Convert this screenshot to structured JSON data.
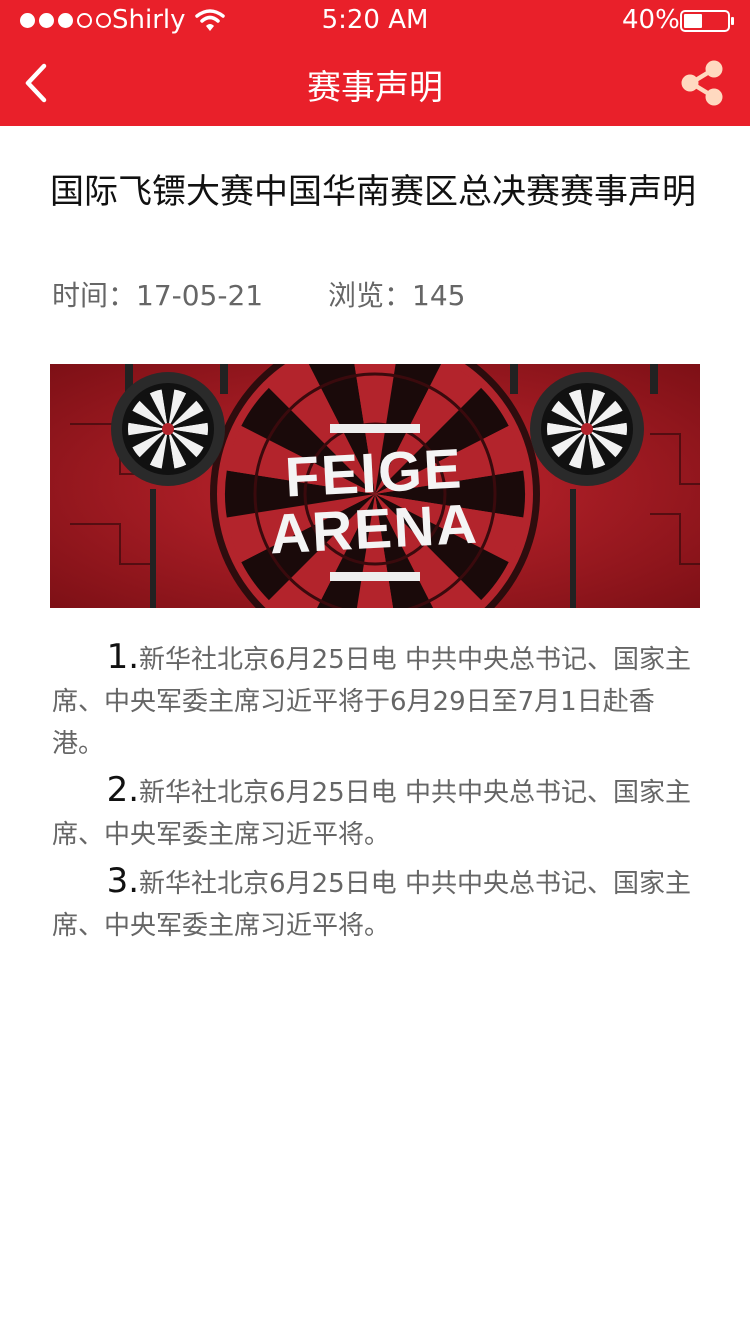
{
  "status_bar": {
    "carrier": "Shirly",
    "time": "5:20 AM",
    "battery": "40%",
    "signal_bars_filled": 3,
    "signal_bars_total": 5
  },
  "nav": {
    "title": "赛事声明",
    "back_icon": "chevron-left-icon",
    "share_icon": "share-icon"
  },
  "article": {
    "title": "国际飞镖大赛中国华南赛区总决赛赛事声明",
    "time_label": "时间：17-05-21",
    "views_label": "浏览：145",
    "banner": {
      "text_line1": "FEIGE",
      "text_line2": "ARENA"
    },
    "paragraphs": [
      {
        "num": "1.",
        "text": "新华社北京6月25日电 中共中央总书记、国家主席、中央军委主席习近平将于6月29日至7月1日赴香港。"
      },
      {
        "num": "2.",
        "text": "新华社北京6月25日电 中共中央总书记、国家主席、中央军委主席习近平将。"
      },
      {
        "num": "3.",
        "text": "新华社北京6月25日电 中共中央总书记、国家主席、中央军委主席习近平将。"
      }
    ]
  },
  "colors": {
    "brand_red": "#e9202a",
    "share_icon": "#ffd9c0",
    "title_text": "#111111",
    "meta_text": "#666666"
  }
}
